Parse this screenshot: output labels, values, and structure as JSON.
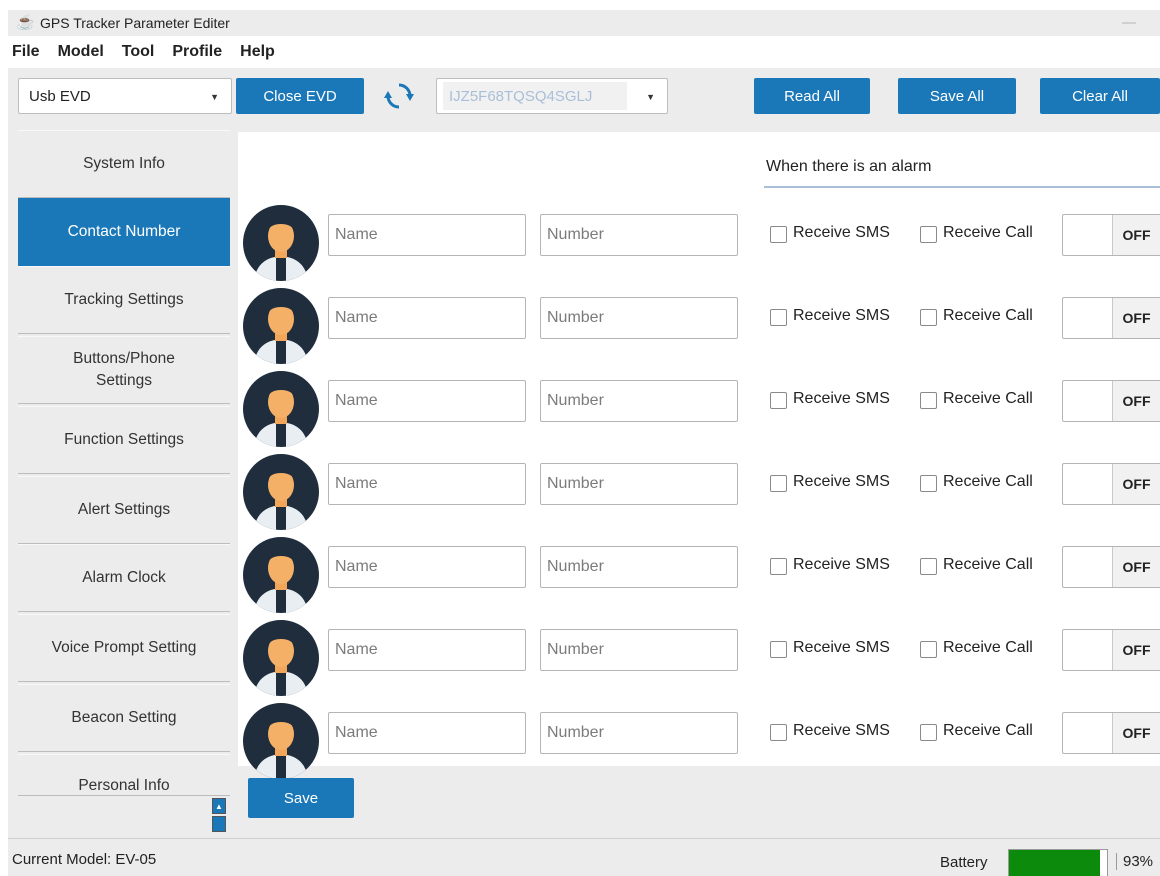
{
  "window": {
    "title": "GPS Tracker Parameter Editer"
  },
  "menu": [
    "File",
    "Model",
    "Tool",
    "Profile",
    "Help"
  ],
  "toolbar": {
    "device_select": "Usb EVD",
    "close_label": "Close EVD",
    "serial_select": "IJZ5F68TQSQ4SGLJ",
    "read_all": "Read All",
    "save_all": "Save All",
    "clear_all": "Clear All"
  },
  "sidebar": {
    "items": [
      {
        "label": "System Info",
        "active": false
      },
      {
        "label": "Contact Number",
        "active": true
      },
      {
        "label": "Tracking Settings",
        "active": false
      },
      {
        "label": "Buttons/Phone Settings",
        "active": false
      },
      {
        "label": "Function Settings",
        "active": false
      },
      {
        "label": "Alert Settings",
        "active": false
      },
      {
        "label": "Alarm Clock",
        "active": false
      },
      {
        "label": "Voice Prompt Setting",
        "active": false
      },
      {
        "label": "Beacon Setting",
        "active": false
      },
      {
        "label": "Personal Info",
        "active": false
      }
    ]
  },
  "contacts": {
    "alarm_header": "When there is an alarm",
    "rows": [
      {
        "name_placeholder": "Name",
        "number_placeholder": "Number",
        "sms_label": "Receive SMS",
        "call_label": "Receive Call",
        "toggle": "OFF"
      },
      {
        "name_placeholder": "Name",
        "number_placeholder": "Number",
        "sms_label": "Receive SMS",
        "call_label": "Receive Call",
        "toggle": "OFF"
      },
      {
        "name_placeholder": "Name",
        "number_placeholder": "Number",
        "sms_label": "Receive SMS",
        "call_label": "Receive Call",
        "toggle": "OFF"
      },
      {
        "name_placeholder": "Name",
        "number_placeholder": "Number",
        "sms_label": "Receive SMS",
        "call_label": "Receive Call",
        "toggle": "OFF"
      },
      {
        "name_placeholder": "Name",
        "number_placeholder": "Number",
        "sms_label": "Receive SMS",
        "call_label": "Receive Call",
        "toggle": "OFF"
      },
      {
        "name_placeholder": "Name",
        "number_placeholder": "Number",
        "sms_label": "Receive SMS",
        "call_label": "Receive Call",
        "toggle": "OFF"
      },
      {
        "name_placeholder": "Name",
        "number_placeholder": "Number",
        "sms_label": "Receive SMS",
        "call_label": "Receive Call",
        "toggle": "OFF"
      }
    ],
    "save_label": "Save"
  },
  "status": {
    "current_model": "Current Model: EV-05",
    "battery_label": "Battery",
    "battery_level": 0.93,
    "battery_text": "93%"
  },
  "colors": {
    "accent": "#1b78b8",
    "battery": "#0b8a0b",
    "chrome": "#ececec"
  },
  "icons": [
    "app-icon",
    "refresh-icon",
    "dropdown-caret-icon",
    "avatar-icon",
    "scroll-up-icon"
  ]
}
